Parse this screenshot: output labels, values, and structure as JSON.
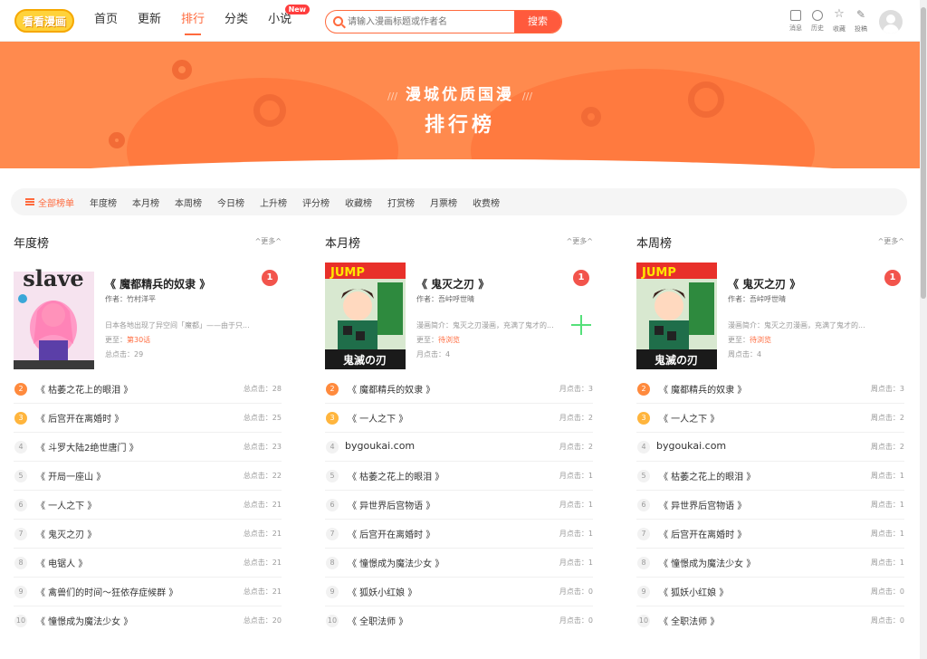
{
  "header": {
    "logo_text": "看看漫画",
    "nav": [
      {
        "label": "首页",
        "active": false
      },
      {
        "label": "更新",
        "active": false
      },
      {
        "label": "排行",
        "active": true
      },
      {
        "label": "分类",
        "active": false
      },
      {
        "label": "小说",
        "active": false,
        "badge": "New"
      }
    ],
    "search": {
      "placeholder": "请输入漫画标题或作者名",
      "button": "搜索"
    },
    "tools": [
      {
        "label": "消息",
        "icon": "message-icon"
      },
      {
        "label": "历史",
        "icon": "history-icon"
      },
      {
        "label": "收藏",
        "icon": "star-icon"
      },
      {
        "label": "投稿",
        "icon": "pen-icon"
      }
    ]
  },
  "banner": {
    "subtitle": "漫城优质国漫",
    "title": "排行榜",
    "accent": "#ff8a4e"
  },
  "categories": {
    "active": "全部榜单",
    "items": [
      "年度榜",
      "本月榜",
      "本周榜",
      "今日榜",
      "上升榜",
      "评分榜",
      "收藏榜",
      "打赏榜",
      "月票榜",
      "收费榜"
    ]
  },
  "columns": [
    {
      "title": "年度榜",
      "more": "^更多^",
      "top": {
        "rank": "1",
        "title": "《 魔都精兵的奴隶 》",
        "author": "作者：竹村洋平",
        "desc": "日本各地出现了异空间「魔都」——由于只...",
        "update_label": "更至：",
        "update_value": "第30话",
        "clicks": "总点击：29",
        "cover_text": "slave"
      },
      "rows": [
        {
          "rank": "2",
          "title": "《 枯萎之花上的眼泪 》",
          "count": "总点击：28"
        },
        {
          "rank": "3",
          "title": "《 后宫开在离婚时 》",
          "count": "总点击：25"
        },
        {
          "rank": "4",
          "title": "《 斗罗大陆2绝世唐门 》",
          "count": "总点击：23"
        },
        {
          "rank": "5",
          "title": "《 开局一座山 》",
          "count": "总点击：22"
        },
        {
          "rank": "6",
          "title": "《 一人之下 》",
          "count": "总点击：21"
        },
        {
          "rank": "7",
          "title": "《 鬼灭之刃 》",
          "count": "总点击：21"
        },
        {
          "rank": "8",
          "title": "《 电锯人 》",
          "count": "总点击：21"
        },
        {
          "rank": "9",
          "title": "《 禽兽们的时间～狂依存症候群 》",
          "count": "总点击：21"
        },
        {
          "rank": "10",
          "title": "《 憧憬成为魔法少女 》",
          "count": "总点击：20"
        }
      ]
    },
    {
      "title": "本月榜",
      "more": "^更多^",
      "top": {
        "rank": "1",
        "title": "《 鬼灭之刃 》",
        "author": "作者：吾峠呼世晴",
        "desc": "漫画简介：鬼灭之刃漫画，充满了鬼才的...",
        "update_label": "更至：",
        "update_value": "待浏览",
        "clicks": "月点击：4",
        "cover_text": "鬼滅の刃"
      },
      "rows": [
        {
          "rank": "2",
          "title": "《 魔都精兵的奴隶 》",
          "count": "月点击：3"
        },
        {
          "rank": "3",
          "title": "《 一人之下 》",
          "count": "月点击：2"
        },
        {
          "rank": "4",
          "title": "bygoukai.com",
          "count": "月点击：2"
        },
        {
          "rank": "5",
          "title": "《 枯萎之花上的眼泪 》",
          "count": "月点击：1"
        },
        {
          "rank": "6",
          "title": "《 异世界后宫物语 》",
          "count": "月点击：1"
        },
        {
          "rank": "7",
          "title": "《 后宫开在离婚时 》",
          "count": "月点击：1"
        },
        {
          "rank": "8",
          "title": "《 憧憬成为魔法少女 》",
          "count": "月点击：1"
        },
        {
          "rank": "9",
          "title": "《 狐妖小红娘 》",
          "count": "月点击：0"
        },
        {
          "rank": "10",
          "title": "《 全职法师 》",
          "count": "月点击：0"
        }
      ]
    },
    {
      "title": "本周榜",
      "more": "^更多^",
      "top": {
        "rank": "1",
        "title": "《 鬼灭之刃 》",
        "author": "作者：吾峠呼世晴",
        "desc": "漫画简介：鬼灭之刃漫画，充满了鬼才的...",
        "update_label": "更至：",
        "update_value": "待浏览",
        "clicks": "周点击：4",
        "cover_text": "鬼滅の刃"
      },
      "rows": [
        {
          "rank": "2",
          "title": "《 魔都精兵的奴隶 》",
          "count": "周点击：3"
        },
        {
          "rank": "3",
          "title": "《 一人之下 》",
          "count": "周点击：2"
        },
        {
          "rank": "4",
          "title": "bygoukai.com",
          "count": "周点击：2"
        },
        {
          "rank": "5",
          "title": "《 枯萎之花上的眼泪 》",
          "count": "周点击：1"
        },
        {
          "rank": "6",
          "title": "《 异世界后宫物语 》",
          "count": "周点击：1"
        },
        {
          "rank": "7",
          "title": "《 后宫开在离婚时 》",
          "count": "周点击：1"
        },
        {
          "rank": "8",
          "title": "《 憧憬成为魔法少女 》",
          "count": "周点击：1"
        },
        {
          "rank": "9",
          "title": "《 狐妖小红娘 》",
          "count": "周点击：0"
        },
        {
          "rank": "10",
          "title": "《 全职法师 》",
          "count": "周点击：0"
        }
      ]
    }
  ]
}
